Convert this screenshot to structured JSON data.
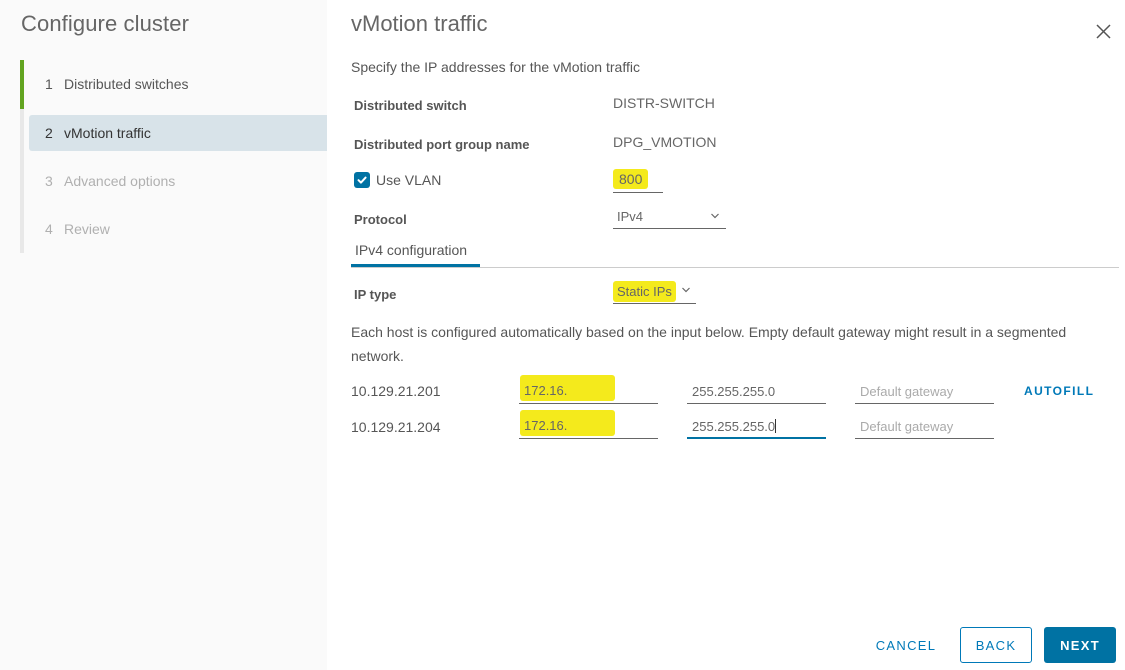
{
  "sidebar": {
    "title": "Configure cluster",
    "steps": [
      {
        "number": "1",
        "label": "Distributed switches",
        "state": "completed"
      },
      {
        "number": "2",
        "label": "vMotion traffic",
        "state": "active"
      },
      {
        "number": "3",
        "label": "Advanced options",
        "state": "disabled"
      },
      {
        "number": "4",
        "label": "Review",
        "state": "disabled"
      }
    ]
  },
  "main": {
    "title": "vMotion traffic",
    "subtitle": "Specify the IP addresses for the vMotion traffic",
    "distributed_switch": {
      "label": "Distributed switch",
      "value": "DISTR-SWITCH"
    },
    "port_group": {
      "label": "Distributed port group name",
      "value": "DPG_VMOTION"
    },
    "use_vlan": {
      "label": "Use VLAN",
      "checked": true,
      "value": "800"
    },
    "protocol": {
      "label": "Protocol",
      "selected": "IPv4"
    },
    "tab": {
      "label": "IPv4 configuration"
    },
    "ip_type": {
      "label": "IP type",
      "selected": "Static IPs"
    },
    "info_text": "Each host is configured automatically based on the input below. Empty default gateway might result in a segmented network.",
    "hosts": [
      {
        "host": "10.129.21.201",
        "ip": "172.16.",
        "subnet_mask": "255.255.255.0",
        "gateway_placeholder": "Default gateway"
      },
      {
        "host": "10.129.21.204",
        "ip": "172.16.",
        "subnet_mask": "255.255.255.0",
        "gateway_placeholder": "Default gateway"
      }
    ],
    "autofill_label": "AUTOFILL"
  },
  "footer": {
    "cancel_label": "CANCEL",
    "back_label": "BACK",
    "next_label": "NEXT"
  },
  "icons": {
    "close": "close-icon",
    "checkbox": "checkmark-icon",
    "dropdown": "chevron-down-icon"
  },
  "colors": {
    "accent": "#0072a3",
    "step_complete": "#62a420",
    "highlight": "#f4ea1c",
    "active_step_bg": "#d8e3e9"
  }
}
